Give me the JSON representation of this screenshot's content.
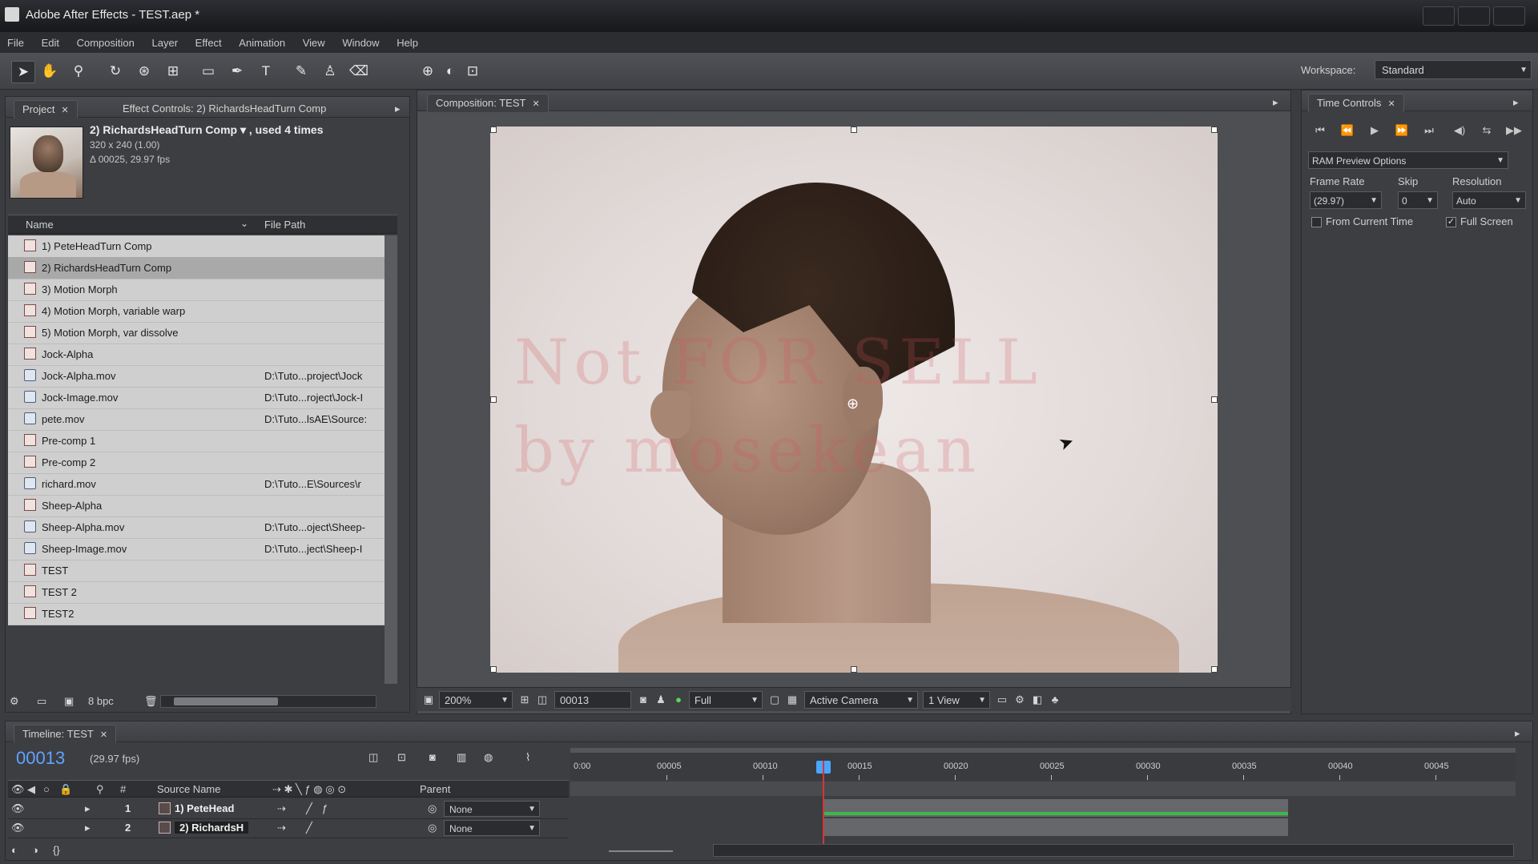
{
  "window": {
    "title": "Adobe After Effects - TEST.aep *"
  },
  "menubar": [
    "File",
    "Edit",
    "Composition",
    "Layer",
    "Effect",
    "Animation",
    "View",
    "Window",
    "Help"
  ],
  "toolbar": {
    "workspace_label": "Workspace:",
    "workspace_value": "Standard",
    "tools": [
      "selection-tool",
      "hand-tool",
      "zoom-tool",
      "rotation-tool",
      "camera-orbit-tool",
      "pan-behind-tool",
      "rectangle-mask-tool",
      "pen-tool",
      "type-tool",
      "brush-tool",
      "clone-stamp-tool",
      "eraser-tool"
    ]
  },
  "project": {
    "tabs": {
      "project": "Project",
      "effect_controls": "Effect Controls: 2) RichardsHeadTurn Comp"
    },
    "info": {
      "name": "2) RichardsHeadTurn Comp ▾ , used 4 times",
      "size": "320 x 240 (1.00)",
      "duration": "Δ 00025, 29.97 fps"
    },
    "columns": {
      "name": "Name",
      "file_path": "File Path"
    },
    "items": [
      {
        "name": "1) PeteHeadTurn Comp",
        "path": "",
        "kind": "comp"
      },
      {
        "name": "2) RichardsHeadTurn Comp",
        "path": "",
        "kind": "comp",
        "selected": true
      },
      {
        "name": "3) Motion Morph",
        "path": "",
        "kind": "comp"
      },
      {
        "name": "4) Motion Morph, variable warp",
        "path": "",
        "kind": "comp"
      },
      {
        "name": "5) Motion Morph, var dissolve",
        "path": "",
        "kind": "comp"
      },
      {
        "name": "Jock-Alpha",
        "path": "",
        "kind": "comp"
      },
      {
        "name": "Jock-Alpha.mov",
        "path": "D:\\Tuto...project\\Jock",
        "kind": "mov"
      },
      {
        "name": "Jock-Image.mov",
        "path": "D:\\Tuto...roject\\Jock-I",
        "kind": "mov"
      },
      {
        "name": "pete.mov",
        "path": "D:\\Tuto...lsAE\\Source:",
        "kind": "mov"
      },
      {
        "name": "Pre-comp 1",
        "path": "",
        "kind": "comp"
      },
      {
        "name": "Pre-comp 2",
        "path": "",
        "kind": "comp"
      },
      {
        "name": "richard.mov",
        "path": "D:\\Tuto...E\\Sources\\r",
        "kind": "mov"
      },
      {
        "name": "Sheep-Alpha",
        "path": "",
        "kind": "comp"
      },
      {
        "name": "Sheep-Alpha.mov",
        "path": "D:\\Tuto...oject\\Sheep-",
        "kind": "mov"
      },
      {
        "name": "Sheep-Image.mov",
        "path": "D:\\Tuto...ject\\Sheep-I",
        "kind": "mov"
      },
      {
        "name": "TEST",
        "path": "",
        "kind": "comp"
      },
      {
        "name": "TEST 2",
        "path": "",
        "kind": "comp"
      },
      {
        "name": "TEST2",
        "path": "",
        "kind": "comp"
      }
    ],
    "footer": {
      "bpc": "8 bpc"
    }
  },
  "composition": {
    "tab": "Composition: TEST",
    "watermark_line1": "Not FOR SELL",
    "watermark_line2": "by mosekean",
    "footer": {
      "zoom": "200%",
      "timecode": "00013",
      "resolution": "Full",
      "camera": "Active Camera",
      "view": "1 View"
    }
  },
  "time_controls": {
    "tab": "Time Controls",
    "ram_preview": "RAM Preview Options",
    "frame_rate_label": "Frame Rate",
    "frame_rate_value": "(29.97)",
    "skip_label": "Skip",
    "skip_value": "0",
    "resolution_label": "Resolution",
    "resolution_value": "Auto",
    "from_current_time": "From Current Time",
    "full_screen": "Full Screen",
    "full_screen_checked": true,
    "from_current_time_checked": false
  },
  "timeline": {
    "tab": "Timeline: TEST",
    "current_time": "00013",
    "fps": "(29.97 fps)",
    "columns": {
      "number": "#",
      "source_name": "Source Name",
      "parent": "Parent"
    },
    "layers": [
      {
        "number": "1",
        "source": "1) PeteHead",
        "parent": "None"
      },
      {
        "number": "2",
        "source": "2) RichardsH",
        "parent": "None",
        "selected": true
      }
    ],
    "ruler_ticks": [
      "0:00",
      "00005",
      "00010",
      "00015",
      "00020",
      "00025",
      "00030",
      "00035",
      "00040",
      "00045"
    ]
  },
  "colors": {
    "accent_time": "#5fa3ff",
    "playhead": "#d6353a",
    "layer_bar_green": "#3bb84a"
  }
}
